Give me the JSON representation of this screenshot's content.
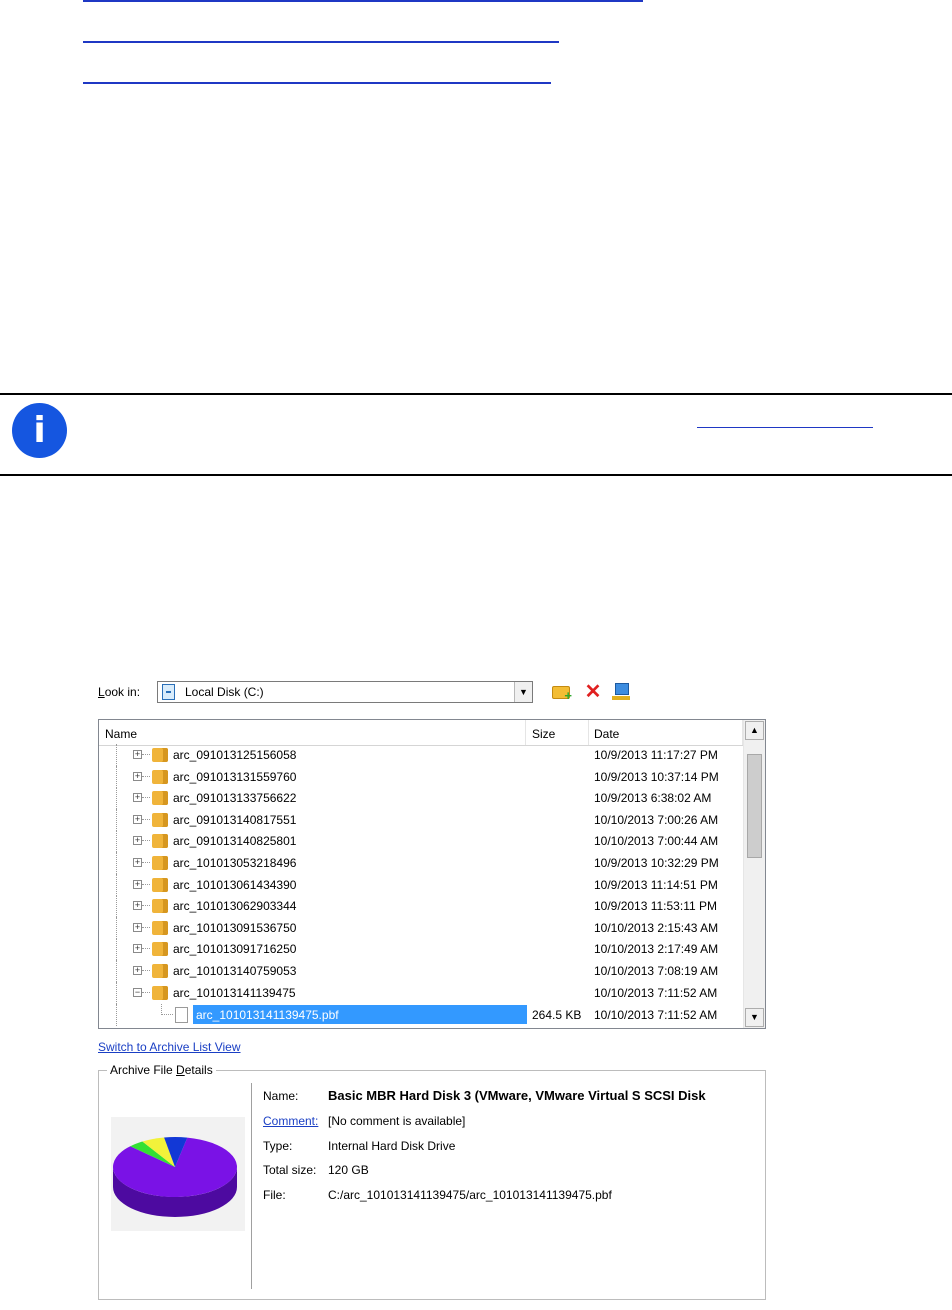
{
  "links": {
    "count": 3
  },
  "info": {
    "icon": "info-icon"
  },
  "dialog": {
    "look_in_label_prefix": "L",
    "look_in_label_rest": "ook in:",
    "look_in_value": "Local Disk (C:)",
    "columns": {
      "name": "Name",
      "size": "Size",
      "date": "Date"
    },
    "rows": [
      {
        "name": "arc_091013125156058",
        "size": "",
        "date": "10/9/2013 11:17:27 PM"
      },
      {
        "name": "arc_091013131559760",
        "size": "",
        "date": "10/9/2013 10:37:14 PM"
      },
      {
        "name": "arc_091013133756622",
        "size": "",
        "date": "10/9/2013 6:38:02 AM"
      },
      {
        "name": "arc_091013140817551",
        "size": "",
        "date": "10/10/2013 7:00:26 AM"
      },
      {
        "name": "arc_091013140825801",
        "size": "",
        "date": "10/10/2013 7:00:44 AM"
      },
      {
        "name": "arc_101013053218496",
        "size": "",
        "date": "10/9/2013 10:32:29 PM"
      },
      {
        "name": "arc_101013061434390",
        "size": "",
        "date": "10/9/2013 11:14:51 PM"
      },
      {
        "name": "arc_101013062903344",
        "size": "",
        "date": "10/9/2013 11:53:11 PM"
      },
      {
        "name": "arc_101013091536750",
        "size": "",
        "date": "10/10/2013 2:15:43 AM"
      },
      {
        "name": "arc_101013091716250",
        "size": "",
        "date": "10/10/2013 2:17:49 AM"
      },
      {
        "name": "arc_101013140759053",
        "size": "",
        "date": "10/10/2013 7:08:19 AM"
      },
      {
        "name": "arc_101013141139475",
        "size": "",
        "date": "10/10/2013 7:11:52 AM"
      }
    ],
    "selected_file": {
      "name": "arc_101013141139475.pbf",
      "size": "264.5 KB",
      "date": "10/10/2013 7:11:52 AM"
    },
    "switch_link": "Switch to Archive List View",
    "details_title_prefix": "Archive File ",
    "details_title_u": "D",
    "details_title_rest": "etails",
    "details": {
      "name_label": "Name:",
      "name_value": "Basic MBR Hard Disk 3 (VMware, VMware Virtual S SCSI Disk",
      "comment_label": "Comment:",
      "comment_value": "[No comment is available]",
      "type_label": "Type:",
      "type_value": "Internal Hard Disk Drive",
      "size_label": "Total size:",
      "size_value": "120 GB",
      "file_label": "File:",
      "file_value": "C:/arc_101013141139475/arc_101013141139475.pbf"
    },
    "pie": {
      "slices": [
        {
          "label": "purple",
          "fraction": 0.84,
          "color": "#7a12e6"
        },
        {
          "label": "green",
          "fraction": 0.04,
          "color": "#33e033"
        },
        {
          "label": "yellow",
          "fraction": 0.06,
          "color": "#f2f23a"
        },
        {
          "label": "blue",
          "fraction": 0.06,
          "color": "#1238d6"
        }
      ]
    }
  }
}
